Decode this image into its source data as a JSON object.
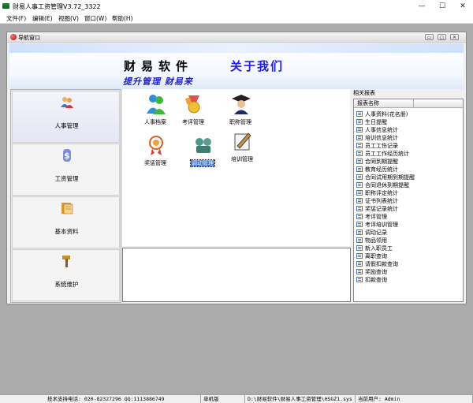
{
  "window": {
    "title": "财易人事工资管理V3.72_3322",
    "minimize": "—",
    "maximize": "☐",
    "close": "✕"
  },
  "menu": [
    "文件(F)",
    "编辑(E)",
    "视图(V)",
    "窗口(W)",
    "帮助(H)"
  ],
  "child_window": {
    "title": "导航窗口"
  },
  "banner": {
    "brand": "财易软件",
    "about": "关于我们",
    "slogan": "提升管理 财易来"
  },
  "nav": [
    {
      "label": "人事管理",
      "icon": "people-icon"
    },
    {
      "label": "工资管理",
      "icon": "money-icon"
    },
    {
      "label": "基本资料",
      "icon": "notebook-icon"
    },
    {
      "label": "系统维护",
      "icon": "hammer-icon"
    }
  ],
  "modules": [
    {
      "label": "人事档案",
      "icon": "person-file-icon"
    },
    {
      "label": "考评管理",
      "icon": "medal-icon"
    },
    {
      "label": "职称管理",
      "icon": "graduate-icon"
    },
    {
      "label": "奖惩管理",
      "icon": "award-icon"
    },
    {
      "label": "调动管理",
      "icon": "transfer-icon"
    },
    {
      "label": "培训管理",
      "icon": "training-icon"
    }
  ],
  "reports": {
    "title": "相关报表",
    "column": "报表名称",
    "items": [
      "人事资料(花名册)",
      "生日提醒",
      "人事信息统计",
      "培训信息统计",
      "员工工伤记录",
      "员工工作经历统计",
      "合同到期提醒",
      "教育经历统计",
      "合同试用期到期提醒",
      "合同退休到期提醒",
      "职称评定统计",
      "证书列表统计",
      "奖惩记录统计",
      "考评管理",
      "考评培训管理",
      "调动记录",
      "物品领用",
      "新入职员工",
      "离职查询",
      "请假扣款查询",
      "奖励查询",
      "扣款查询"
    ]
  },
  "status": {
    "support": "技术支持电话: 020-82327296 QQ:1113886749",
    "mode": "单机版",
    "path": "D:\\财易软件\\财易人事工资管理\\HSGZ1.sys",
    "user": "当前用户: Admin"
  }
}
